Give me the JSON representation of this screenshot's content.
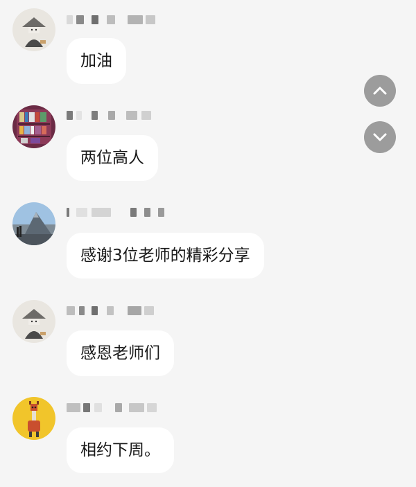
{
  "messages": [
    {
      "avatar": "straw-hat-figure-avatar",
      "text": "加油"
    },
    {
      "avatar": "bookshelf-avatar",
      "text": "两位高人"
    },
    {
      "avatar": "mountain-landscape-avatar",
      "text": "感谢3位老师的精彩分享"
    },
    {
      "avatar": "straw-hat-figure-avatar",
      "text": "感恩老师们"
    },
    {
      "avatar": "giraffe-avatar",
      "text": "相约下周。"
    }
  ],
  "nav": {
    "up_icon": "chevron-up-icon",
    "down_icon": "chevron-down-icon"
  },
  "colors": {
    "background": "#f5f5f5",
    "bubble": "#ffffff",
    "nav_button": "#9c9c9c"
  }
}
